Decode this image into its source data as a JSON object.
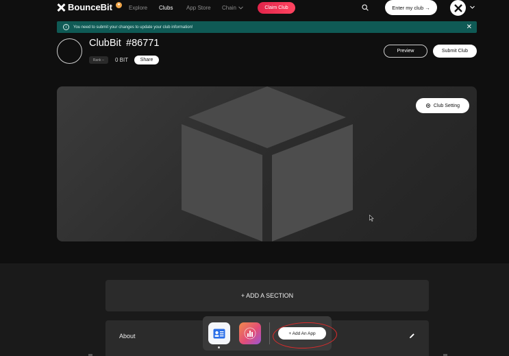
{
  "nav": {
    "brand": "BounceBit",
    "brand_badge": "●",
    "links": [
      "Explore",
      "Clubs",
      "App Store",
      "Chain"
    ],
    "claim_label": "Claim Club",
    "enter_label": "Enter my club →"
  },
  "notice": {
    "text": "You need to submit your changes to update your club information!",
    "info_glyph": "i",
    "close_glyph": "✕"
  },
  "profile": {
    "name": "ClubBit",
    "id": "#86771",
    "rank": "Rank --",
    "bit": "0 BIT",
    "share_label": "Share",
    "preview_label": "Preview",
    "submit_label": "Submit Club"
  },
  "banner": {
    "setting_label": "Club Setting"
  },
  "sections": {
    "add_section_label": "+ ADD A SECTION",
    "about_label": "About"
  },
  "dock": {
    "add_app_label": "+ Add An App"
  },
  "colors": {
    "accent_red": "#ff3b5c",
    "notice_bg": "#0f5a55",
    "annotation_red": "#e12b2b"
  },
  "icons": [
    "bouncebit-logo-icon",
    "search-icon",
    "chevron-down-icon",
    "info-icon",
    "close-icon",
    "gear-icon",
    "pencil-icon",
    "profile-card-icon",
    "chart-icon",
    "cube-icon"
  ]
}
